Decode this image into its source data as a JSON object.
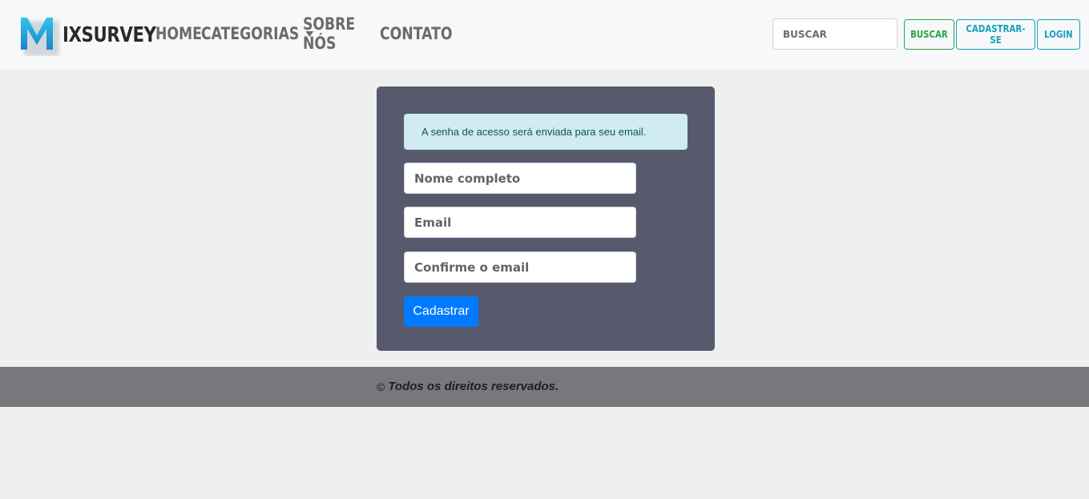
{
  "brand": {
    "logo_letter": "M",
    "name": "IXSURVEY"
  },
  "nav": {
    "items": [
      {
        "label": "HOME"
      },
      {
        "label": "CATEGORIAS"
      },
      {
        "label": "SOBRE NÓS"
      },
      {
        "label": "CONTATO"
      }
    ]
  },
  "search": {
    "placeholder": "BUSCAR"
  },
  "header_buttons": {
    "search_label": "BUSCAR",
    "register_label": "CADASTRAR-SE",
    "login_label": "LOGIN"
  },
  "form": {
    "alert_text": "A senha de acesso será enviada para seu email.",
    "name_placeholder": "Nome completo",
    "email_placeholder": "Email",
    "confirm_email_placeholder": "Confirme o email",
    "submit_label": "Cadastrar"
  },
  "footer": {
    "copyright_symbol": "©",
    "text": "Todos os direitos reservados."
  },
  "colors": {
    "navbar_bg": "#f7f8f9",
    "card_bg": "#575a6d",
    "alert_bg": "#d1ecf1",
    "primary": "#007bff",
    "success": "#28a745",
    "info": "#17a2b8",
    "footer_bg": "#77787b",
    "page_bg": "#efefef"
  }
}
